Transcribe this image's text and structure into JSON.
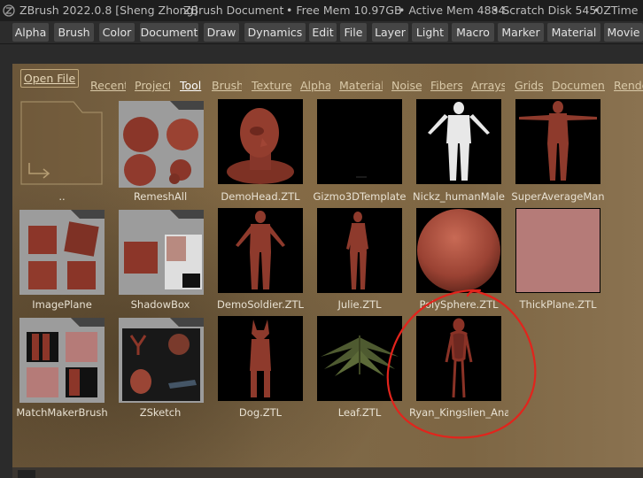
{
  "window": {
    "title": "ZBrush 2022.0.8 [Sheng Zhong]",
    "document_label": "ZBrush Document",
    "free_mem": "• Free Mem 10.97GB",
    "active_mem": "• Active Mem 4884",
    "scratch_disk": "• Scratch Disk 5450",
    "ztime": "• ZTime •"
  },
  "menubar": {
    "items": [
      "Alpha",
      "Brush",
      "Color",
      "Document",
      "Draw",
      "Dynamics",
      "Edit",
      "File",
      "Layer",
      "Light",
      "Macro",
      "Marker",
      "Material",
      "Movie"
    ]
  },
  "browser": {
    "open_file_label": "Open File",
    "tabs": [
      "Recent",
      "Project",
      "Tool",
      "Brush",
      "Texture",
      "Alpha",
      "Material",
      "Noise",
      "Fibers",
      "Arrays",
      "Grids",
      "Document",
      "Render"
    ],
    "active_tab": "Tool",
    "items": [
      {
        "label": "..",
        "kind": "parent-folder"
      },
      {
        "label": "RemeshAll",
        "kind": "folder"
      },
      {
        "label": "DemoHead.ZTL",
        "kind": "file"
      },
      {
        "label": "Gizmo3DTemplate",
        "kind": "file"
      },
      {
        "label": "Nickz_humanMale",
        "kind": "file"
      },
      {
        "label": "SuperAverageMan",
        "kind": "file"
      },
      {
        "label": "ImagePlane",
        "kind": "folder"
      },
      {
        "label": "ShadowBox",
        "kind": "folder"
      },
      {
        "label": "DemoSoldier.ZTL",
        "kind": "file"
      },
      {
        "label": "Julie.ZTL",
        "kind": "file"
      },
      {
        "label": "PolySphere.ZTL",
        "kind": "file"
      },
      {
        "label": "ThickPlane.ZTL",
        "kind": "file"
      },
      {
        "label": "MatchMakerBrush",
        "kind": "folder"
      },
      {
        "label": "ZSketch",
        "kind": "folder"
      },
      {
        "label": "Dog.ZTL",
        "kind": "file"
      },
      {
        "label": "Leaf.ZTL",
        "kind": "file"
      },
      {
        "label": "Ryan_Kingslien_Anatomy",
        "kind": "file"
      }
    ]
  },
  "colors": {
    "model_red": "#8e3a2c",
    "annotation_red": "#e2241c",
    "folder_gray": "#9a9a9a",
    "browser_brown": "#7d6644"
  }
}
